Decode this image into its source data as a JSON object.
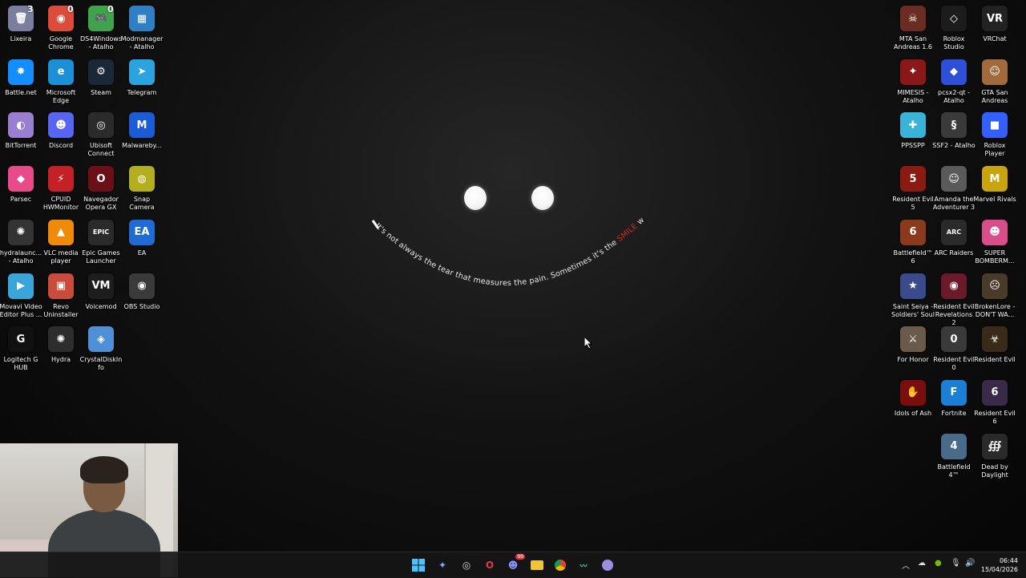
{
  "wallpaper": {
    "quote_start": "It's not always the tear that measures the pain. Sometimes it's the ",
    "quote_highlight": "SMILE",
    "quote_end": " we fake"
  },
  "desktop": {
    "left_icons": [
      {
        "label": "Lixeira",
        "glyph": "🗑",
        "color": "#7a7fa0",
        "badge": "3",
        "icon": "recycle-bin-icon"
      },
      {
        "label": "Google Chrome",
        "glyph": "◉",
        "color": "#dd4b39",
        "badge": "0",
        "icon": "chrome-icon"
      },
      {
        "label": "DS4Windows - Atalho",
        "glyph": "🎮",
        "color": "#3fa34d",
        "badge": "0",
        "icon": "gamepad-icon"
      },
      {
        "label": "Modmanager - Atalho",
        "glyph": "▦",
        "color": "#2f7fc4",
        "badge": "",
        "icon": "modmanager-icon"
      },
      {
        "label": "Battle.net",
        "glyph": "✸",
        "color": "#148eff",
        "badge": "",
        "icon": "battlenet-icon"
      },
      {
        "label": "Microsoft Edge",
        "glyph": "e",
        "color": "#1c8fd6",
        "badge": "",
        "icon": "edge-icon"
      },
      {
        "label": "Steam",
        "glyph": "⚙",
        "color": "#1b2838",
        "badge": "",
        "icon": "steam-icon"
      },
      {
        "label": "Telegram",
        "glyph": "➤",
        "color": "#2aa3de",
        "badge": "",
        "icon": "telegram-icon"
      },
      {
        "label": "BitTorrent",
        "glyph": "◐",
        "color": "#9a7fd1",
        "badge": "",
        "icon": "bittorrent-icon"
      },
      {
        "label": "Discord",
        "glyph": "☻",
        "color": "#5865f2",
        "badge": "",
        "icon": "discord-icon"
      },
      {
        "label": "Ubisoft Connect",
        "glyph": "◎",
        "color": "#2b2b2b",
        "badge": "",
        "icon": "ubisoft-icon"
      },
      {
        "label": "Malwareby...",
        "glyph": "M",
        "color": "#1c5bd6",
        "badge": "",
        "icon": "malwarebytes-icon"
      },
      {
        "label": "Parsec",
        "glyph": "◆",
        "color": "#e94b8a",
        "badge": "",
        "icon": "parsec-icon"
      },
      {
        "label": "CPUID HWMonitor",
        "glyph": "⚡",
        "color": "#c32126",
        "badge": "",
        "icon": "hwmonitor-icon"
      },
      {
        "label": "Navegador Opera GX",
        "glyph": "O",
        "color": "#6b0f18",
        "badge": "",
        "icon": "opera-gx-icon"
      },
      {
        "label": "Snap Camera",
        "glyph": "◍",
        "color": "#b2ae1e",
        "badge": "",
        "icon": "snap-camera-icon"
      },
      {
        "label": "hydralaunc... - Atalho",
        "glyph": "✺",
        "color": "#333333",
        "badge": "",
        "icon": "hydra-launcher-icon"
      },
      {
        "label": "VLC media player",
        "glyph": "▲",
        "color": "#f08a0b",
        "badge": "",
        "icon": "vlc-icon"
      },
      {
        "label": "Epic Games Launcher",
        "glyph": "EPIC",
        "color": "#2a2a2a",
        "badge": "",
        "icon": "epic-games-icon"
      },
      {
        "label": "EA",
        "glyph": "EA",
        "color": "#1e6bd6",
        "badge": "",
        "icon": "ea-icon"
      },
      {
        "label": "Movavi Video Editor Plus ...",
        "glyph": "▶",
        "color": "#3aa5d8",
        "badge": "",
        "icon": "movavi-icon"
      },
      {
        "label": "Revo Uninstaller",
        "glyph": "▣",
        "color": "#c94b3b",
        "badge": "",
        "icon": "revo-uninstaller-icon"
      },
      {
        "label": "Voicemod",
        "glyph": "VM",
        "color": "#1d1d1d",
        "badge": "",
        "icon": "voicemod-icon"
      },
      {
        "label": "OBS Studio",
        "glyph": "◉",
        "color": "#3a3a3a",
        "badge": "",
        "icon": "obs-icon"
      },
      {
        "label": "Logitech G HUB",
        "glyph": "G",
        "color": "#111111",
        "badge": "",
        "icon": "logitech-icon"
      },
      {
        "label": "Hydra",
        "glyph": "✺",
        "color": "#2d2d2d",
        "badge": "",
        "icon": "hydra-icon"
      },
      {
        "label": "CrystalDiskInfo",
        "glyph": "◈",
        "color": "#4f8fd6",
        "badge": "",
        "icon": "crystaldiskinfo-icon"
      }
    ],
    "right_icons": [
      {
        "label": "MTA San Andreas 1.6",
        "glyph": "☠",
        "color": "#6b2c22",
        "badge": "",
        "icon": "mta-icon"
      },
      {
        "label": "Roblox Studio",
        "glyph": "◇",
        "color": "#1c1c1c",
        "badge": "",
        "icon": "roblox-studio-icon"
      },
      {
        "label": "VRChat",
        "glyph": "VR",
        "color": "#222222",
        "badge": "",
        "icon": "vrchat-icon"
      },
      {
        "label": "MIMESIS - Atalho",
        "glyph": "✦",
        "color": "#8a1818",
        "badge": "",
        "icon": "mimesis-icon"
      },
      {
        "label": "pcsx2-qt - Atalho",
        "glyph": "◆",
        "color": "#2f4fd6",
        "badge": "",
        "icon": "pcsx2-icon"
      },
      {
        "label": "GTA San Andreas",
        "glyph": "☺",
        "color": "#a06a3a",
        "badge": "",
        "icon": "gta-sa-icon"
      },
      {
        "label": "PPSSPP",
        "glyph": "✚",
        "color": "#3ab3d9",
        "badge": "",
        "icon": "ppsspp-icon"
      },
      {
        "label": "SSF2 - Atalho",
        "glyph": "§",
        "color": "#3a3a3a",
        "badge": "",
        "icon": "ssf2-icon"
      },
      {
        "label": "Roblox Player",
        "glyph": "■",
        "color": "#335fff",
        "badge": "",
        "icon": "roblox-player-icon"
      },
      {
        "label": "Resident Evil 5",
        "glyph": "5",
        "color": "#8a1a12",
        "badge": "",
        "icon": "re5-icon"
      },
      {
        "label": "Amanda the Adventurer 3",
        "glyph": "☺",
        "color": "#5a5a5a",
        "badge": "",
        "icon": "amanda-icon"
      },
      {
        "label": "Marvel Rivals",
        "glyph": "M",
        "color": "#c9a40d",
        "badge": "",
        "icon": "marvel-rivals-icon"
      },
      {
        "label": "Battlefield™ 6",
        "glyph": "6",
        "color": "#8a3a1a",
        "badge": "",
        "icon": "bf6-icon"
      },
      {
        "label": "ARC Raiders",
        "glyph": "ARC",
        "color": "#2a2a2a",
        "badge": "",
        "icon": "arc-raiders-icon"
      },
      {
        "label": "SUPER BOMBERM...",
        "glyph": "☻",
        "color": "#d94e8a",
        "badge": "",
        "icon": "bomberman-icon"
      },
      {
        "label": "Saint Seiya - Soldiers' Soul",
        "glyph": "★",
        "color": "#3a4a8a",
        "badge": "",
        "icon": "saint-seiya-icon"
      },
      {
        "label": "Resident Evil Revelations 2",
        "glyph": "◉",
        "color": "#6a1a2a",
        "badge": "",
        "icon": "re-rev2-icon"
      },
      {
        "label": "BrokenLore - DON'T WA...",
        "glyph": "☹",
        "color": "#4a3a2a",
        "badge": "",
        "icon": "brokenlore-icon"
      },
      {
        "label": "For Honor",
        "glyph": "⚔",
        "color": "#6a5a4a",
        "badge": "",
        "icon": "for-honor-icon"
      },
      {
        "label": "Resident Evil 0",
        "glyph": "0",
        "color": "#3a3a3a",
        "badge": "",
        "icon": "re0-icon"
      },
      {
        "label": "Resident Evil",
        "glyph": "☣",
        "color": "#3a2a1a",
        "badge": "",
        "icon": "re-icon"
      },
      {
        "label": "Idols of Ash",
        "glyph": "✋",
        "color": "#7a0e0e",
        "badge": "",
        "icon": "idols-of-ash-icon"
      },
      {
        "label": "Fortnite",
        "glyph": "F",
        "color": "#1c7fd6",
        "badge": "",
        "icon": "fortnite-icon"
      },
      {
        "label": "Resident Evil 6",
        "glyph": "6",
        "color": "#3a2a4a",
        "badge": "",
        "icon": "re6-icon"
      },
      {
        "label": "Battlefield 4™",
        "glyph": "4",
        "color": "#4a6a8a",
        "badge": "",
        "icon": "bf4-icon"
      },
      {
        "label": "Dead by Daylight",
        "glyph": "∰",
        "color": "#2a2a2a",
        "badge": "",
        "icon": "dbd-icon"
      }
    ]
  },
  "taskbar": {
    "clock_time": "06:44",
    "clock_date": "15/04/2026",
    "discord_badge": "99"
  }
}
